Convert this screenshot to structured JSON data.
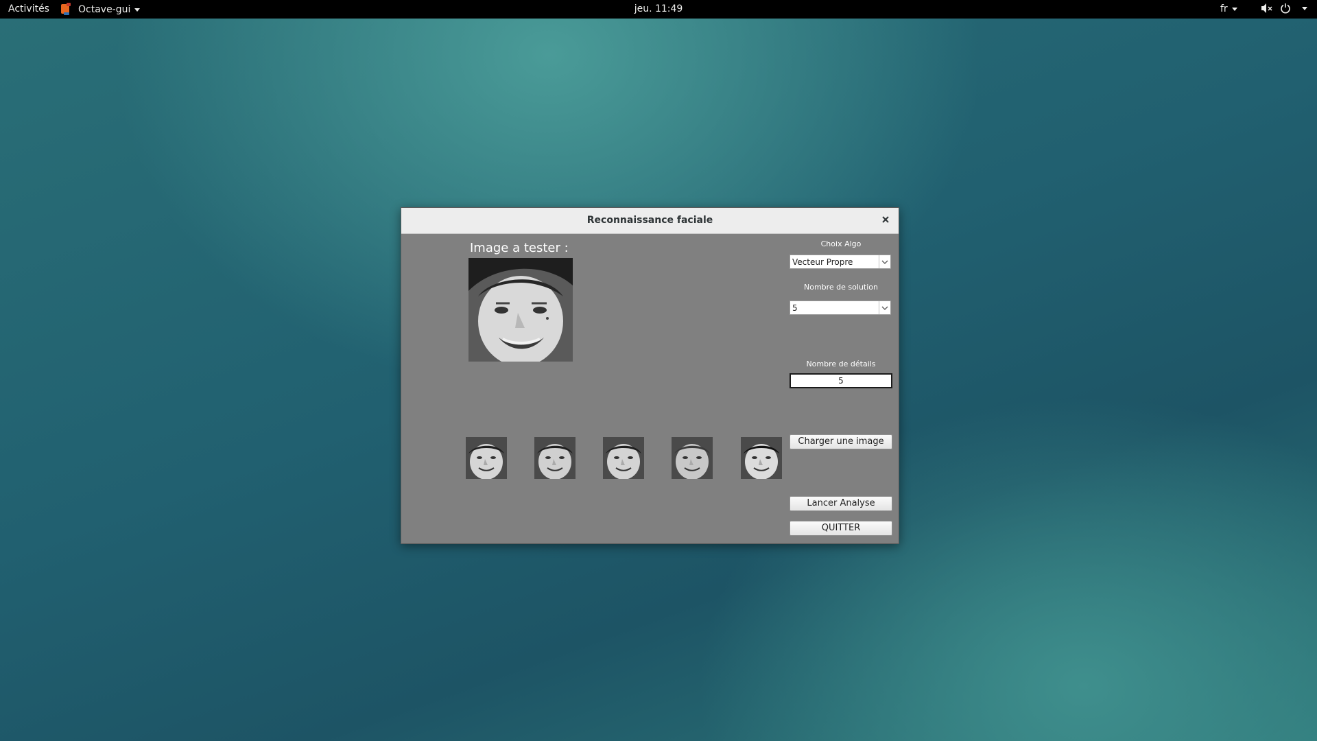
{
  "topbar": {
    "activities": "Activités",
    "app_name": "Octave-gui",
    "clock": "jeu. 11:49",
    "language": "fr",
    "icons": [
      "volume-muted-icon",
      "power-icon"
    ]
  },
  "dialog": {
    "title": "Reconnaissance faciale",
    "test_image_label": "Image a tester :",
    "controls": {
      "algo_label": "Choix Algo",
      "algo_value": "Vecteur Propre",
      "solutions_label": "Nombre de solution",
      "solutions_value": "5",
      "details_label": "Nombre de détails",
      "details_value": "5",
      "load_button": "Charger une image",
      "analyse_button": "Lancer Analyse",
      "quit_button": "QUITTER"
    },
    "result_count": 5
  },
  "colors": {
    "dialog_bg": "#808080",
    "topbar_bg": "#000000",
    "desktop_teal": "#2a6f77"
  }
}
